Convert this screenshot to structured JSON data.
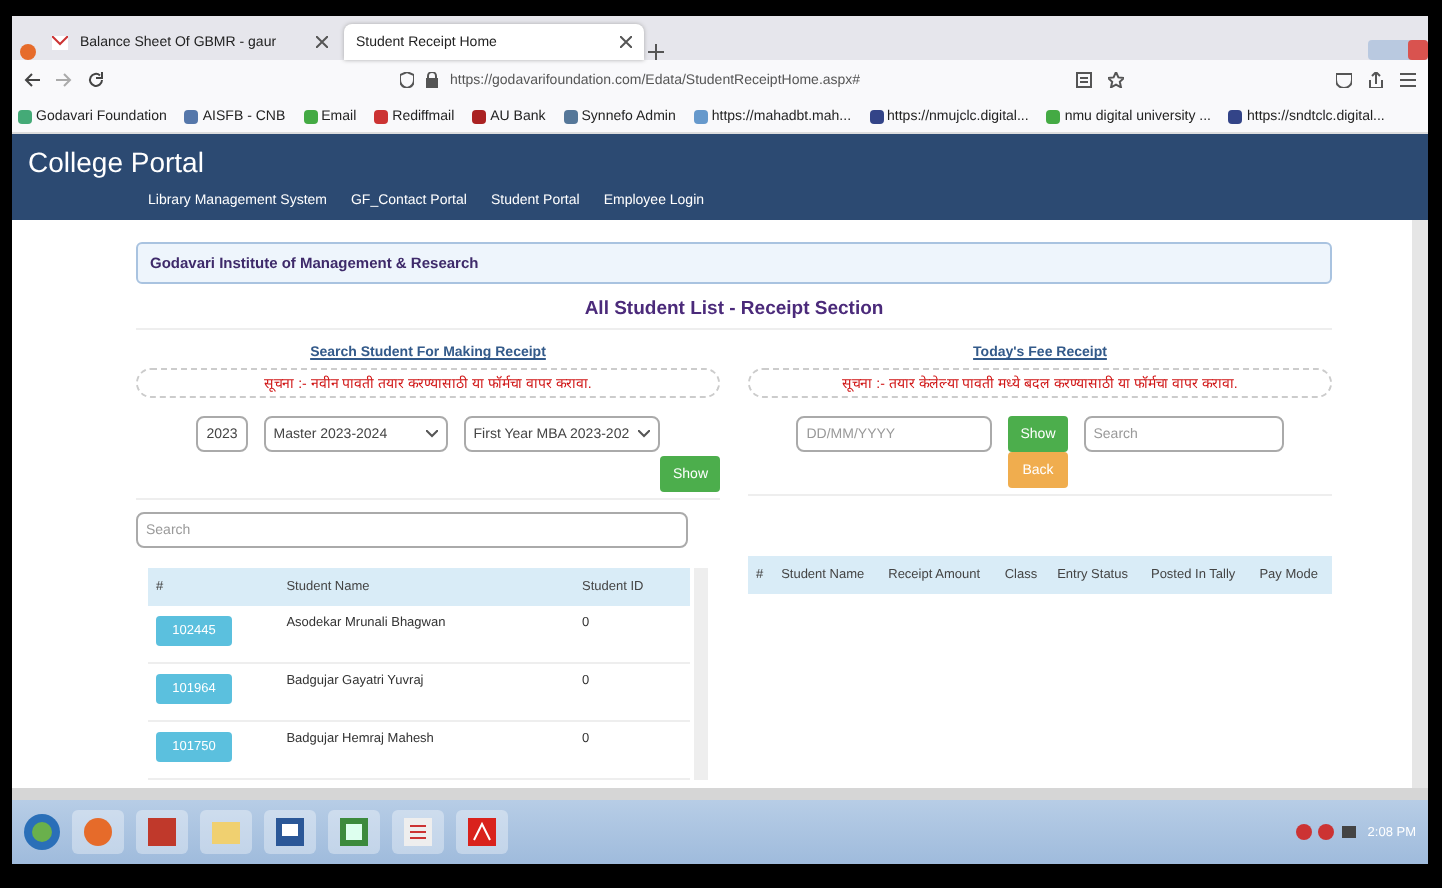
{
  "browser": {
    "tabs": [
      {
        "label": "Balance Sheet Of GBMR - gaur",
        "selected": false
      },
      {
        "label": "Student Receipt Home",
        "selected": true
      }
    ],
    "address": "https://godavarifoundation.com/Edata/StudentReceiptHome.aspx#",
    "bookmarks": [
      "Godavari Foundation",
      "AISFB - CNB",
      "Email",
      "Rediffmail",
      "AU Bank",
      "Synnefo Admin",
      "https://mahadbt.mah...",
      "https://nmujclc.digital...",
      "nmu digital university ...",
      "https://sndtclc.digital..."
    ]
  },
  "header": {
    "title": "College Portal",
    "nav": [
      "Library Management System",
      "GF_Contact Portal",
      "Student Portal",
      "Employee Login"
    ]
  },
  "institute": "Godavari Institute of Management & Research",
  "heading": "All Student List - Receipt Section",
  "make_receipt": {
    "link": "Search Student For Making Receipt",
    "notice": "सूचना :- नवीन पावती तयार करण्यासाठी या फॉर्मचा वापर करावा.",
    "year": "2023",
    "session": "Master 2023-2024",
    "class": "First Year MBA 2023-202",
    "show_button": "Show",
    "search_placeholder": "Search",
    "table": {
      "columns": [
        "#",
        "Student Name",
        "Student ID"
      ],
      "rows": [
        {
          "id": "102445",
          "name": "Asodekar Mrunali Bhagwan",
          "student_id": "0"
        },
        {
          "id": "101964",
          "name": "Badgujar Gayatri Yuvraj",
          "student_id": "0"
        },
        {
          "id": "101750",
          "name": "Badgujar Hemraj Mahesh",
          "student_id": "0"
        }
      ]
    }
  },
  "todays_receipt": {
    "link": "Today's Fee Receipt",
    "notice": "सूचना :- तयार केलेल्या पावती मध्ये बदल करण्यासाठी या फॉर्मचा वापर करावा.",
    "date_placeholder": "DD/MM/YYYY",
    "show_button": "Show",
    "search_placeholder": "Search",
    "back_button": "Back",
    "table": {
      "columns": [
        "#",
        "Student Name",
        "Receipt Amount",
        "Class",
        "Entry Status",
        "Posted In Tally",
        "Pay Mode"
      ]
    }
  },
  "taskbar": {
    "clock": "2:08 PM"
  }
}
